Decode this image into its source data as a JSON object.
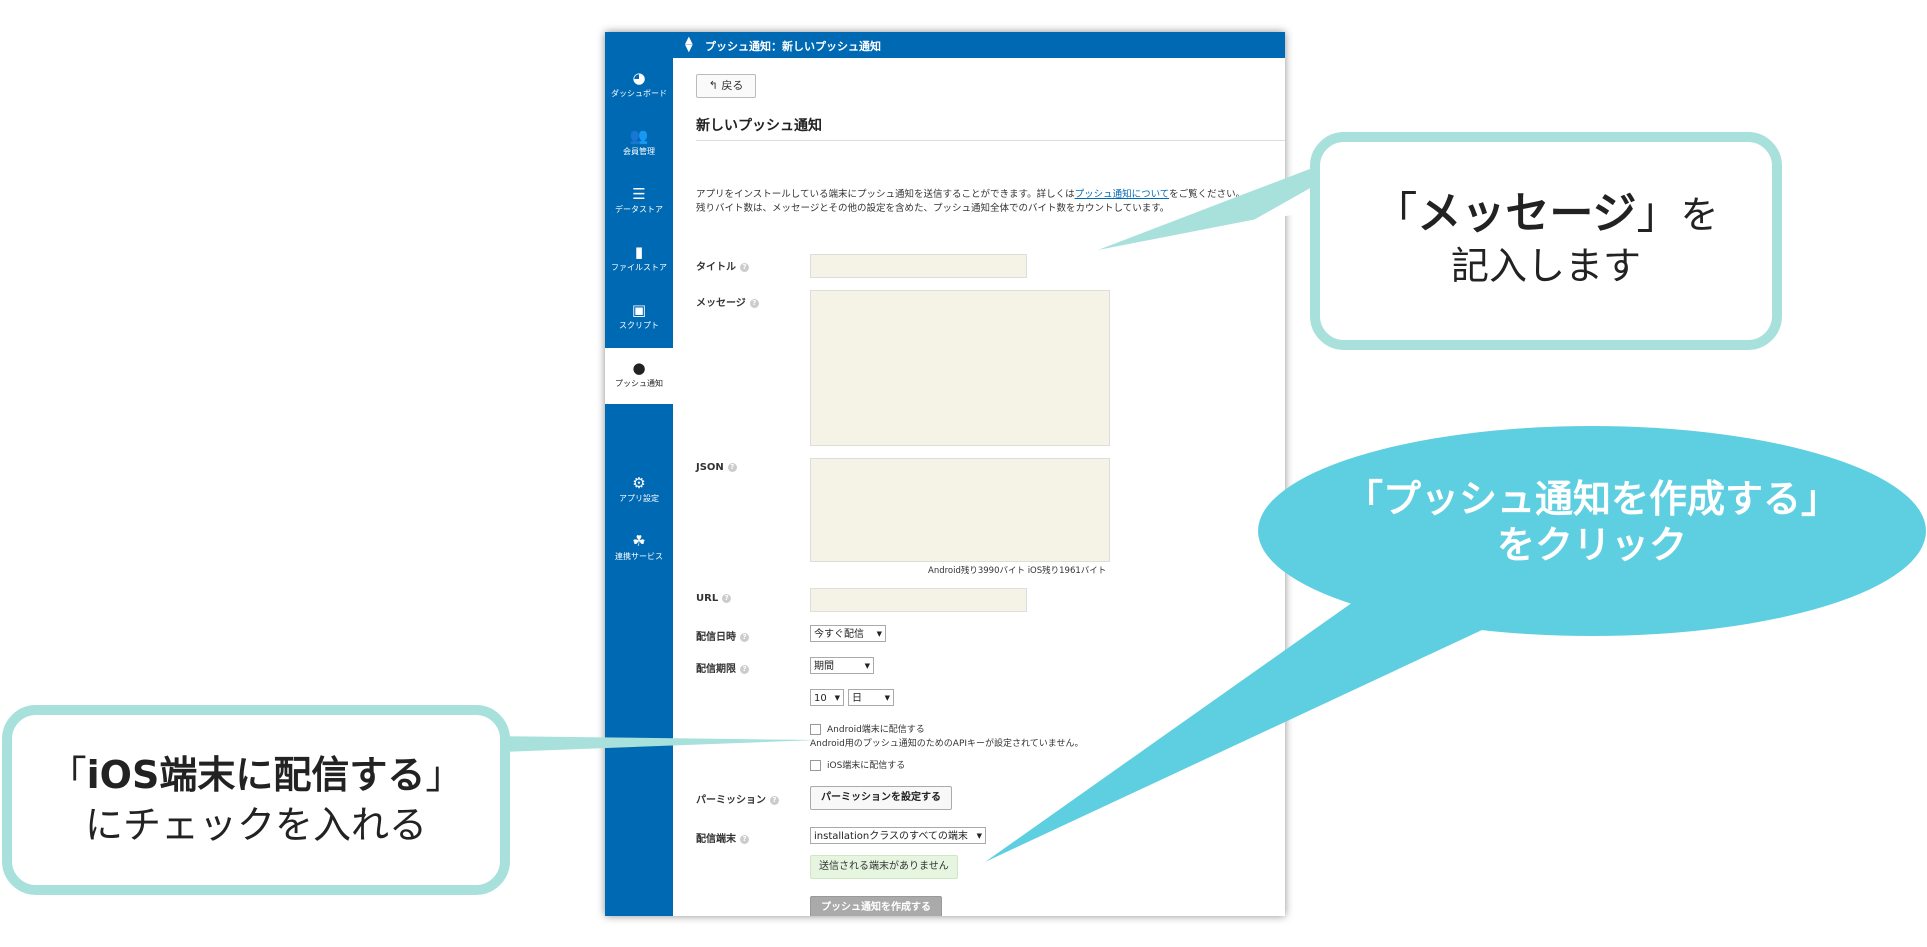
{
  "topbar": {
    "breadcrumb": "プッシュ通知：新しいプッシュ通知",
    "handle_icon": "sort-handle-icon"
  },
  "sidebar": {
    "items": [
      {
        "label": "ダッシュボード",
        "icon": "gauge-icon",
        "glyph": "◕"
      },
      {
        "label": "会員管理",
        "icon": "users-icon",
        "glyph": "👥"
      },
      {
        "label": "データストア",
        "icon": "database-icon",
        "glyph": "☰"
      },
      {
        "label": "ファイルストア",
        "icon": "file-icon",
        "glyph": "▮"
      },
      {
        "label": "スクリプト",
        "icon": "script-icon",
        "glyph": "▣"
      },
      {
        "label": "プッシュ通知",
        "icon": "chat-bubble-icon",
        "glyph": "●",
        "active": true
      },
      {
        "label": "アプリ設定",
        "icon": "gears-icon",
        "glyph": "⚙"
      },
      {
        "label": "連携サービス",
        "icon": "share-icon",
        "glyph": "☘"
      }
    ]
  },
  "main": {
    "back_label": "戻る",
    "back_glyph": "↰",
    "title": "新しいプッシュ通知",
    "desc_1": "アプリをインストールしている端末にプッシュ通知を送信することができます。詳しくは",
    "desc_link": "プッシュ通知について",
    "desc_2": "をご覧ください。",
    "desc_3": "残りバイト数は、メッセージとその他の設定を含めた、プッシュ通知全体でのバイト数をカウントしています。",
    "help_glyph": "?",
    "fields": {
      "title_label": "タイトル",
      "message_label": "メッセージ",
      "json_label": "JSON",
      "bytes_remaining": "Android残り3990バイト iOS残り1961バイト",
      "url_label": "URL",
      "delivery_time_label": "配信日時",
      "delivery_time_value": "今すぐ配信",
      "expiry_label": "配信期限",
      "expiry_value": "期間",
      "expiry_number": "10",
      "expiry_unit": "日",
      "android_checkbox_label": "Android端末に配信する",
      "android_warning": "Android用のプッシュ通知のためのAPIキーが設定されていません。",
      "ios_checkbox_label": "iOS端末に配信する",
      "permission_label": "パーミッション",
      "permission_button": "パーミッションを設定する",
      "target_label": "配信端末",
      "target_value": "installationクラスのすべての端末",
      "no_targets_notice": "送信される端末がありません",
      "create_button": "プッシュ通知を作成する"
    }
  },
  "callouts": {
    "message": {
      "open_bracket": "「",
      "keyword": "メッセージ",
      "close_bracket": "」",
      "suffix": "を",
      "line2": "記入します"
    },
    "create": {
      "line1": "「プッシュ通知を作成する」",
      "line2": "をクリック"
    },
    "ios": {
      "open_bracket": "「",
      "keyword": "iOS端末に配信する",
      "close_bracket": "」",
      "line2": "にチェックを入れる"
    },
    "colors": {
      "box_border": "#a8e0dc",
      "ellipse": "#5ecfe0",
      "brand": "#0069b4"
    }
  }
}
